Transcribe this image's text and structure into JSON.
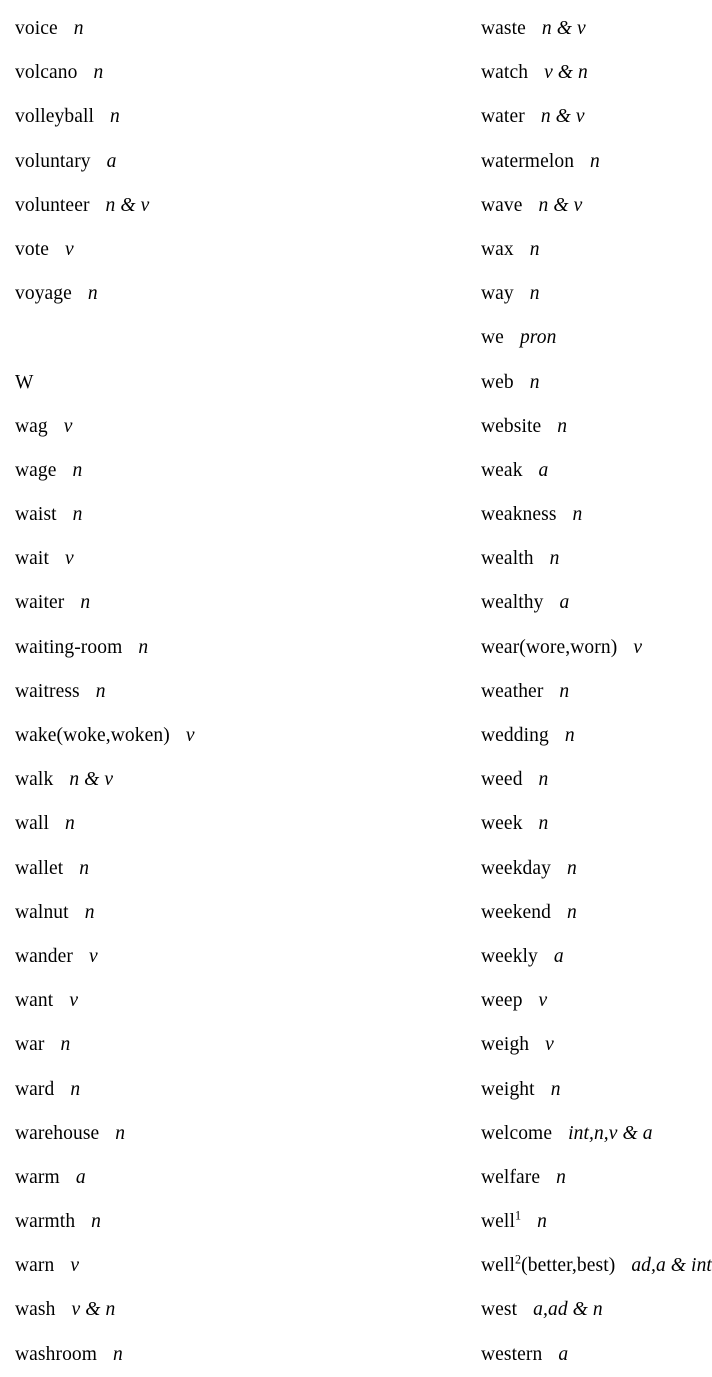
{
  "page": {
    "kind": "dictionary-word-list",
    "letter_section": "W",
    "text_color": "#000000",
    "background_color": "#ffffff"
  },
  "left_column": [
    {
      "word": "voice",
      "pos": "n"
    },
    {
      "word": "volcano",
      "pos": "n"
    },
    {
      "word": "volleyball",
      "pos": "n"
    },
    {
      "word": "voluntary",
      "pos": "a"
    },
    {
      "word": "volunteer",
      "pos": "n & v"
    },
    {
      "word": "vote",
      "pos": "v"
    },
    {
      "word": "voyage",
      "pos": "n"
    },
    {
      "spacer": true
    },
    {
      "word": "W",
      "pos": "",
      "section": true
    },
    {
      "word": "wag",
      "pos": "v"
    },
    {
      "word": "wage",
      "pos": "n"
    },
    {
      "word": "waist",
      "pos": "n"
    },
    {
      "word": "wait",
      "pos": "v"
    },
    {
      "word": "waiter",
      "pos": "n"
    },
    {
      "word": "waiting-room",
      "pos": "n"
    },
    {
      "word": "waitress",
      "pos": "n"
    },
    {
      "word": "wake(woke,woken)",
      "pos": "v"
    },
    {
      "word": "walk",
      "pos": "n & v"
    },
    {
      "word": "wall",
      "pos": "n"
    },
    {
      "word": "wallet",
      "pos": "n"
    },
    {
      "word": "walnut",
      "pos": "n"
    },
    {
      "word": "wander",
      "pos": "v"
    },
    {
      "word": "want",
      "pos": "v"
    },
    {
      "word": "war",
      "pos": "n"
    },
    {
      "word": "ward",
      "pos": "n"
    },
    {
      "word": "warehouse",
      "pos": "n"
    },
    {
      "word": "warm",
      "pos": "a"
    },
    {
      "word": "warmth",
      "pos": "n"
    },
    {
      "word": "warn",
      "pos": "v"
    },
    {
      "word": "wash",
      "pos": "v & n"
    },
    {
      "word": "washroom",
      "pos": "n"
    }
  ],
  "right_column": [
    {
      "word": "waste",
      "pos": "n & v"
    },
    {
      "word": "watch",
      "pos": "v & n"
    },
    {
      "word": "water",
      "pos": "n & v"
    },
    {
      "word": "watermelon",
      "pos": "n"
    },
    {
      "word": "wave",
      "pos": "n & v"
    },
    {
      "word": "wax",
      "pos": "n"
    },
    {
      "word": "way",
      "pos": "n"
    },
    {
      "word": "we",
      "pos": "pron"
    },
    {
      "word": "web",
      "pos": "n"
    },
    {
      "word": "website",
      "pos": "n"
    },
    {
      "word": "weak",
      "pos": "a"
    },
    {
      "word": "weakness",
      "pos": "n"
    },
    {
      "word": "wealth",
      "pos": "n"
    },
    {
      "word": "wealthy",
      "pos": "a"
    },
    {
      "word": "wear(wore,worn)",
      "pos": "v"
    },
    {
      "word": "weather",
      "pos": "n"
    },
    {
      "word": "wedding",
      "pos": "n"
    },
    {
      "word": "weed",
      "pos": "n"
    },
    {
      "word": "week",
      "pos": "n"
    },
    {
      "word": "weekday",
      "pos": "n"
    },
    {
      "word": "weekend",
      "pos": "n"
    },
    {
      "word": "weekly",
      "pos": "a"
    },
    {
      "word": "weep",
      "pos": "v"
    },
    {
      "word": "weigh",
      "pos": "v"
    },
    {
      "word": "weight",
      "pos": "n"
    },
    {
      "word": "welcome",
      "pos": "int,n,v & a"
    },
    {
      "word": "welfare",
      "pos": "n"
    },
    {
      "word": "well",
      "superscript": "1",
      "pos": "n"
    },
    {
      "word": "well",
      "superscript": "2",
      "suffix": "(better,best)",
      "pos": "ad,a & int"
    },
    {
      "word": "west",
      "pos": "a,ad & n"
    },
    {
      "word": "western",
      "pos": "a"
    }
  ]
}
